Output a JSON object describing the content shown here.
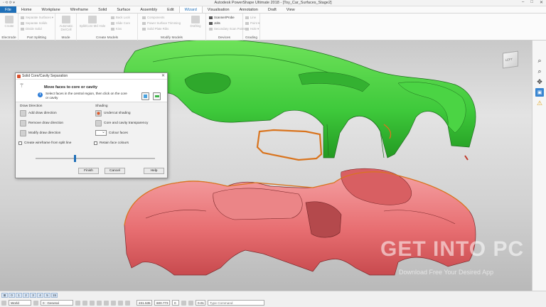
{
  "window": {
    "title": "Autodesk PowerShape Ultimate 2018 - [Toy_Car_Surfaces_Stage2]",
    "quick_access": "▫ ⟲ ⟳ ▾"
  },
  "tabs": [
    "File",
    "Home",
    "Workplane",
    "Wireframe",
    "Solid",
    "Surface",
    "Assembly",
    "Edit",
    "Wizard",
    "Visualisation",
    "Annotation",
    "Draft",
    "View"
  ],
  "active_tab": "Wizard",
  "ribbon": {
    "electrode": {
      "button": "Create",
      "label": "Electrode"
    },
    "part_splitting": {
      "items": [
        "Separate Surfaces ▾",
        "Separate Solids",
        "Divide Solid"
      ],
      "label": "Part Splitting"
    },
    "mode": {
      "button": "Automatic Die/Cell",
      "label": "Mode"
    },
    "create_models": {
      "big": "Split/Core Mcl Hole",
      "items": [
        "Back Lock",
        "Slide Core",
        "Kiss"
      ],
      "label": "Create Models"
    },
    "modify_models": {
      "big": "Drafting",
      "items": [
        "Components",
        "Power Surface Trimming",
        "Solid Plate Ribs"
      ],
      "label": "Modify Models"
    },
    "devices": {
      "items": [
        "Scanner/Probe",
        "Jolts",
        "Secondary Scan Points"
      ],
      "label": "Devices"
    },
    "grading": {
      "items": [
        "Line",
        "Point ▾",
        "Hole ▾"
      ],
      "label": "Grading"
    }
  },
  "dialog": {
    "title": "Solid Core/Cavity Separation",
    "heading": "Move faces to core or cavity",
    "instruction": "Select faces in the central region, then click on the core or cavity",
    "draw_direction": {
      "label": "Draw Direction",
      "items": [
        "Add draw direction",
        "Remove draw direction",
        "Modify draw direction"
      ]
    },
    "shading": {
      "label": "Shading",
      "items": [
        "Undercut shading",
        "Core and cavity transparency",
        "Colour faces"
      ]
    },
    "create_wireframe": "Create wireframe from split line",
    "retain_face_colours": "Retain face colours",
    "slider_value": 0.33,
    "buttons": {
      "finish": "Finish",
      "cancel": "Cancel",
      "help": "Help"
    }
  },
  "status": {
    "layers": [
      "⊞",
      "0",
      "1",
      "2",
      "3",
      "4",
      "5",
      "15"
    ],
    "world": "World",
    "general": "0 : General",
    "coord_x": "231.535",
    "coord_y": "600.773",
    "zero": "0",
    "tolerance": "0.01",
    "command_placeholder": "Type Command"
  },
  "viewcube": {
    "face": "LEFT"
  },
  "colors": {
    "cavity": "#3ec93b",
    "core": "#e86f72",
    "split_line": "#d9741e",
    "accent": "#1e6fb8"
  },
  "watermark": {
    "main": "GET INTO PC",
    "sub": "Download Free Your Desired App"
  }
}
